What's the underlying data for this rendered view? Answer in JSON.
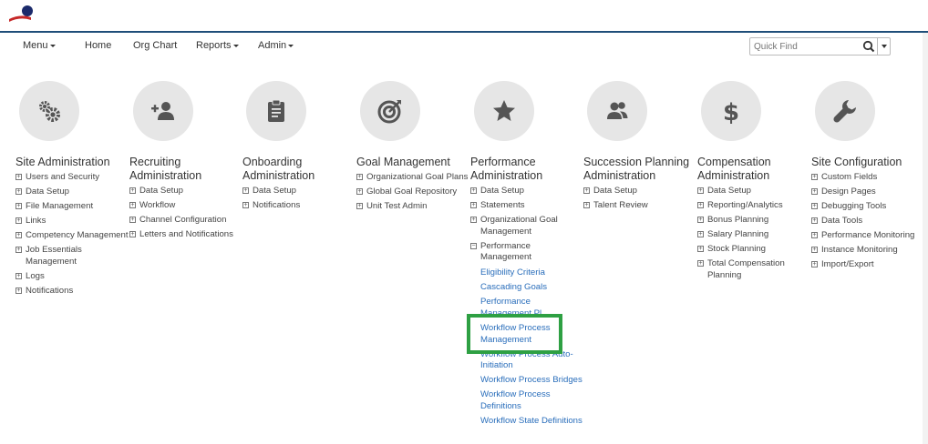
{
  "colors": {
    "accent_bar": "#1f4e79",
    "link": "#2a6ebb",
    "highlight": "#2ea043",
    "circle_bg": "#e6e6e6",
    "icon": "#555555"
  },
  "nav": {
    "menu": "Menu",
    "home": "Home",
    "org_chart": "Org Chart",
    "reports": "Reports",
    "admin": "Admin",
    "quick_find_placeholder": "Quick Find"
  },
  "tiles": [
    {
      "title": "Site Administration",
      "icon": "gears-icon",
      "items": [
        "Users and Security",
        "Data Setup",
        "File Management",
        "Links",
        "Competency Management",
        "Job Essentials Management",
        "Logs",
        "Notifications"
      ]
    },
    {
      "title": "Recruiting Administration",
      "icon": "add-user-icon",
      "items": [
        "Data Setup",
        "Workflow",
        "Channel Configuration",
        "Letters and Notifications"
      ]
    },
    {
      "title": "Onboarding Administration",
      "icon": "clipboard-icon",
      "items": [
        "Data Setup",
        "Notifications"
      ]
    },
    {
      "title": "Goal Management",
      "icon": "target-icon",
      "items": [
        "Organizational Goal Plans",
        "Global Goal Repository",
        "Unit Test Admin"
      ]
    },
    {
      "title": "Performance Administration",
      "icon": "star-icon",
      "items": [
        "Data Setup",
        "Statements",
        "Organizational Goal Management",
        "Performance Management"
      ],
      "subitems": [
        "Eligibility Criteria",
        "Cascading Goals",
        "Performance Management Pl...",
        "Workflow Process Management",
        "Workflow Process Auto-Initiation",
        "Workflow Process Bridges",
        "Workflow Process Definitions",
        "Workflow State Definitions"
      ]
    },
    {
      "title": "Succession Planning Administration",
      "icon": "people-icon",
      "items": [
        "Data Setup",
        "Talent Review"
      ]
    },
    {
      "title": "Compensation Administration",
      "icon": "dollar-icon",
      "items": [
        "Data Setup",
        "Reporting/Analytics",
        "Bonus Planning",
        "Salary Planning",
        "Stock Planning",
        "Total Compensation Planning"
      ]
    },
    {
      "title": "Site Configuration",
      "icon": "wrench-icon",
      "items": [
        "Custom Fields",
        "Design Pages",
        "Debugging Tools",
        "Data Tools",
        "Performance Monitoring",
        "Instance Monitoring",
        "Import/Export"
      ]
    }
  ]
}
